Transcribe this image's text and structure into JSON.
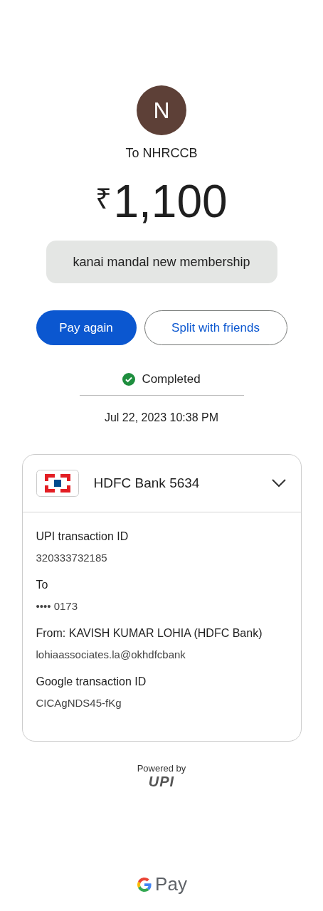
{
  "payee": {
    "initial": "N",
    "title": "To NHRCCB"
  },
  "amount": {
    "currency": "₹",
    "value": "1,100"
  },
  "note": "kanai mandal new membership",
  "buttons": [
    {
      "label": "Pay again",
      "kind": "primary"
    },
    {
      "label": "Split with friends",
      "kind": "outline"
    }
  ],
  "status": {
    "label": "Completed",
    "kind": "success"
  },
  "date": "Jul 22, 2023 10:38 PM",
  "account": {
    "name": "HDFC Bank 5634"
  },
  "details": [
    {
      "label": "UPI transaction ID",
      "value": "320333732185"
    },
    {
      "label": "To",
      "value": "•••• 0173"
    },
    {
      "label": "From: KAVISH KUMAR LOHIA (HDFC Bank)",
      "value": "lohiaassociates.la@okhdfcbank"
    },
    {
      "label": "Google transaction ID",
      "value": "CICAgNDS45-fKg"
    }
  ],
  "footer": {
    "powered_by": "Powered by",
    "upi_logo": "UPI",
    "brand": "Pay"
  }
}
